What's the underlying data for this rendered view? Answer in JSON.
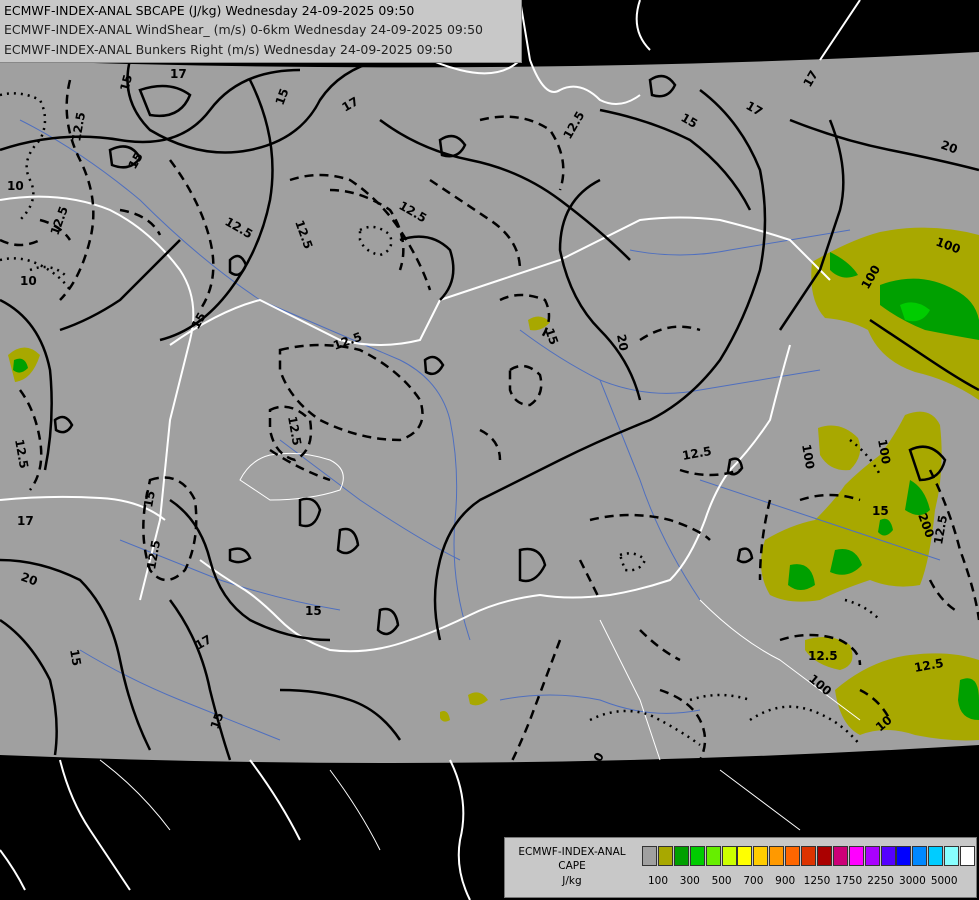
{
  "header": {
    "lines": [
      "ECMWF-INDEX-ANAL SBCAPE (J/kg) Wednesday 24-09-2025 09:50",
      "ECMWF-INDEX-ANAL WindShear_ (m/s) 0-6km Wednesday 24-09-2025 09:50",
      "ECMWF-INDEX-ANAL Bunkers Right (m/s) Wednesday 24-09-2025 09:50"
    ]
  },
  "legend": {
    "title_lines": [
      "ECMWF-INDEX-ANAL",
      "CAPE",
      "J/kg"
    ],
    "colors": [
      "#a0a0a0",
      "#a8a800",
      "#00a000",
      "#00cc00",
      "#66ee00",
      "#ccff00",
      "#ffff00",
      "#ffcc00",
      "#ff9900",
      "#ff6600",
      "#dd3300",
      "#aa0000",
      "#cc0077",
      "#ff00ff",
      "#aa00ff",
      "#5500ff",
      "#0000ff",
      "#0088ff",
      "#00ccff",
      "#88ffff",
      "#ffffff"
    ],
    "tick_labels": [
      "100",
      "300",
      "500",
      "700",
      "900",
      "1250",
      "1750",
      "2250",
      "3000",
      "5000"
    ]
  },
  "map": {
    "background_color": "#a0a0a0",
    "contour_labels": {
      "windshear": [
        "10",
        "12.5",
        "15",
        "17",
        "20"
      ],
      "cape": [
        "100",
        "200"
      ]
    }
  }
}
